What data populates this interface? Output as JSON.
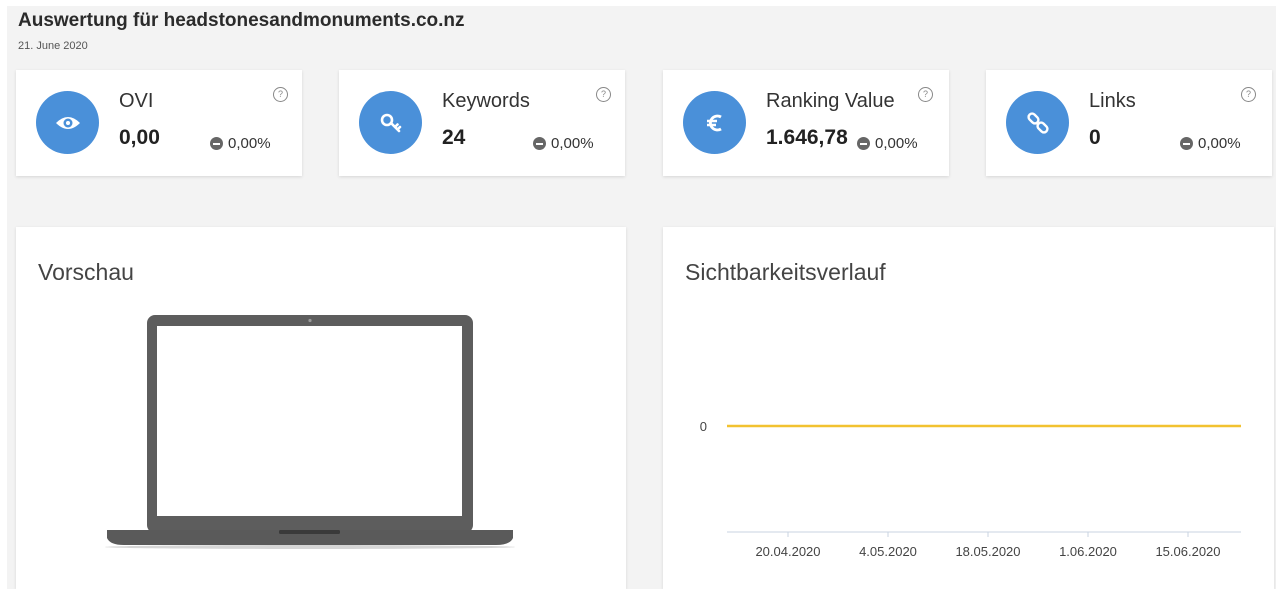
{
  "header": {
    "title": "Auswertung für headstonesandmonuments.co.nz",
    "date": "21. June 2020"
  },
  "kpis": [
    {
      "label": "OVI",
      "value": "0,00",
      "change": "0,00%",
      "icon": "eye-icon",
      "help": "?"
    },
    {
      "label": "Keywords",
      "value": "24",
      "change": "0,00%",
      "icon": "key-icon",
      "help": "?"
    },
    {
      "label": "Ranking Value",
      "value": "1.646,78",
      "change": "0,00%",
      "icon": "euro-icon",
      "help": "?"
    },
    {
      "label": "Links",
      "value": "0",
      "change": "0,00%",
      "icon": "link-icon",
      "help": "?"
    }
  ],
  "preview": {
    "title": "Vorschau"
  },
  "visibility": {
    "title": "Sichtbarkeitsverlauf"
  },
  "colors": {
    "accent": "#4a90d9",
    "line": "#f2c230",
    "background": "#f3f3f3"
  },
  "chart_data": {
    "type": "line",
    "title": "Sichtbarkeitsverlauf",
    "x": [
      "20.04.2020",
      "4.05.2020",
      "18.05.2020",
      "1.06.2020",
      "15.06.2020"
    ],
    "series": [
      {
        "values": [
          0,
          0,
          0,
          0,
          0
        ]
      }
    ],
    "y_ticks": [
      "0"
    ],
    "grid": false
  }
}
